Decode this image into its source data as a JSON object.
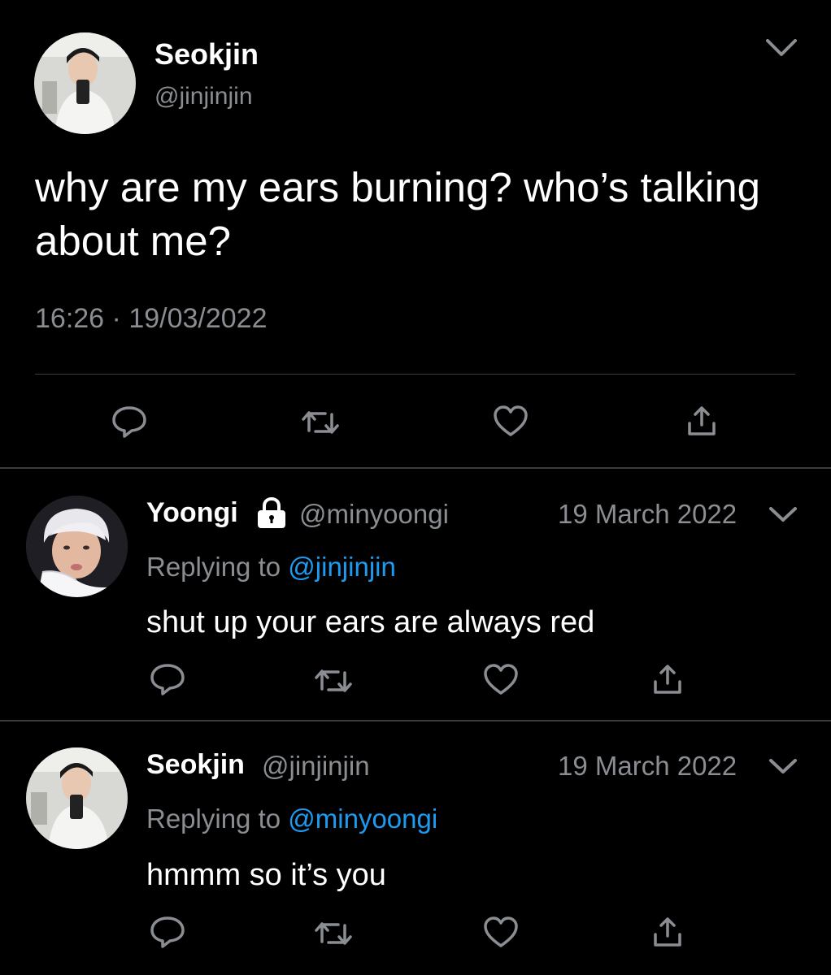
{
  "main_tweet": {
    "author_name": "Seokjin",
    "author_handle": "@jinjinjin",
    "text": "why are my ears burning? who’s talking about me?",
    "time": "16:26",
    "separator": "·",
    "date": "19/03/2022",
    "avatar_icon": "profile-photo"
  },
  "replies": [
    {
      "author_name": "Yoongi",
      "protected_icon": "lock-icon",
      "author_handle": "@minyoongi",
      "date": "19 March 2022",
      "replying_prefix": "Replying to",
      "replying_to": "@jinjinjin",
      "text": "shut up your ears are always red"
    },
    {
      "author_name": "Seokjin",
      "author_handle": "@jinjinjin",
      "date": "19 March 2022",
      "replying_prefix": "Replying to",
      "replying_to": "@minyoongi",
      "text": "hmmm so it’s you"
    }
  ],
  "actions": [
    "reply-icon",
    "retweet-icon",
    "like-icon",
    "share-icon"
  ],
  "colors": {
    "background": "#000000",
    "text_primary": "#ffffff",
    "text_secondary": "#8a8d91",
    "link": "#1d9bf0",
    "divider": "#3a3d40"
  }
}
